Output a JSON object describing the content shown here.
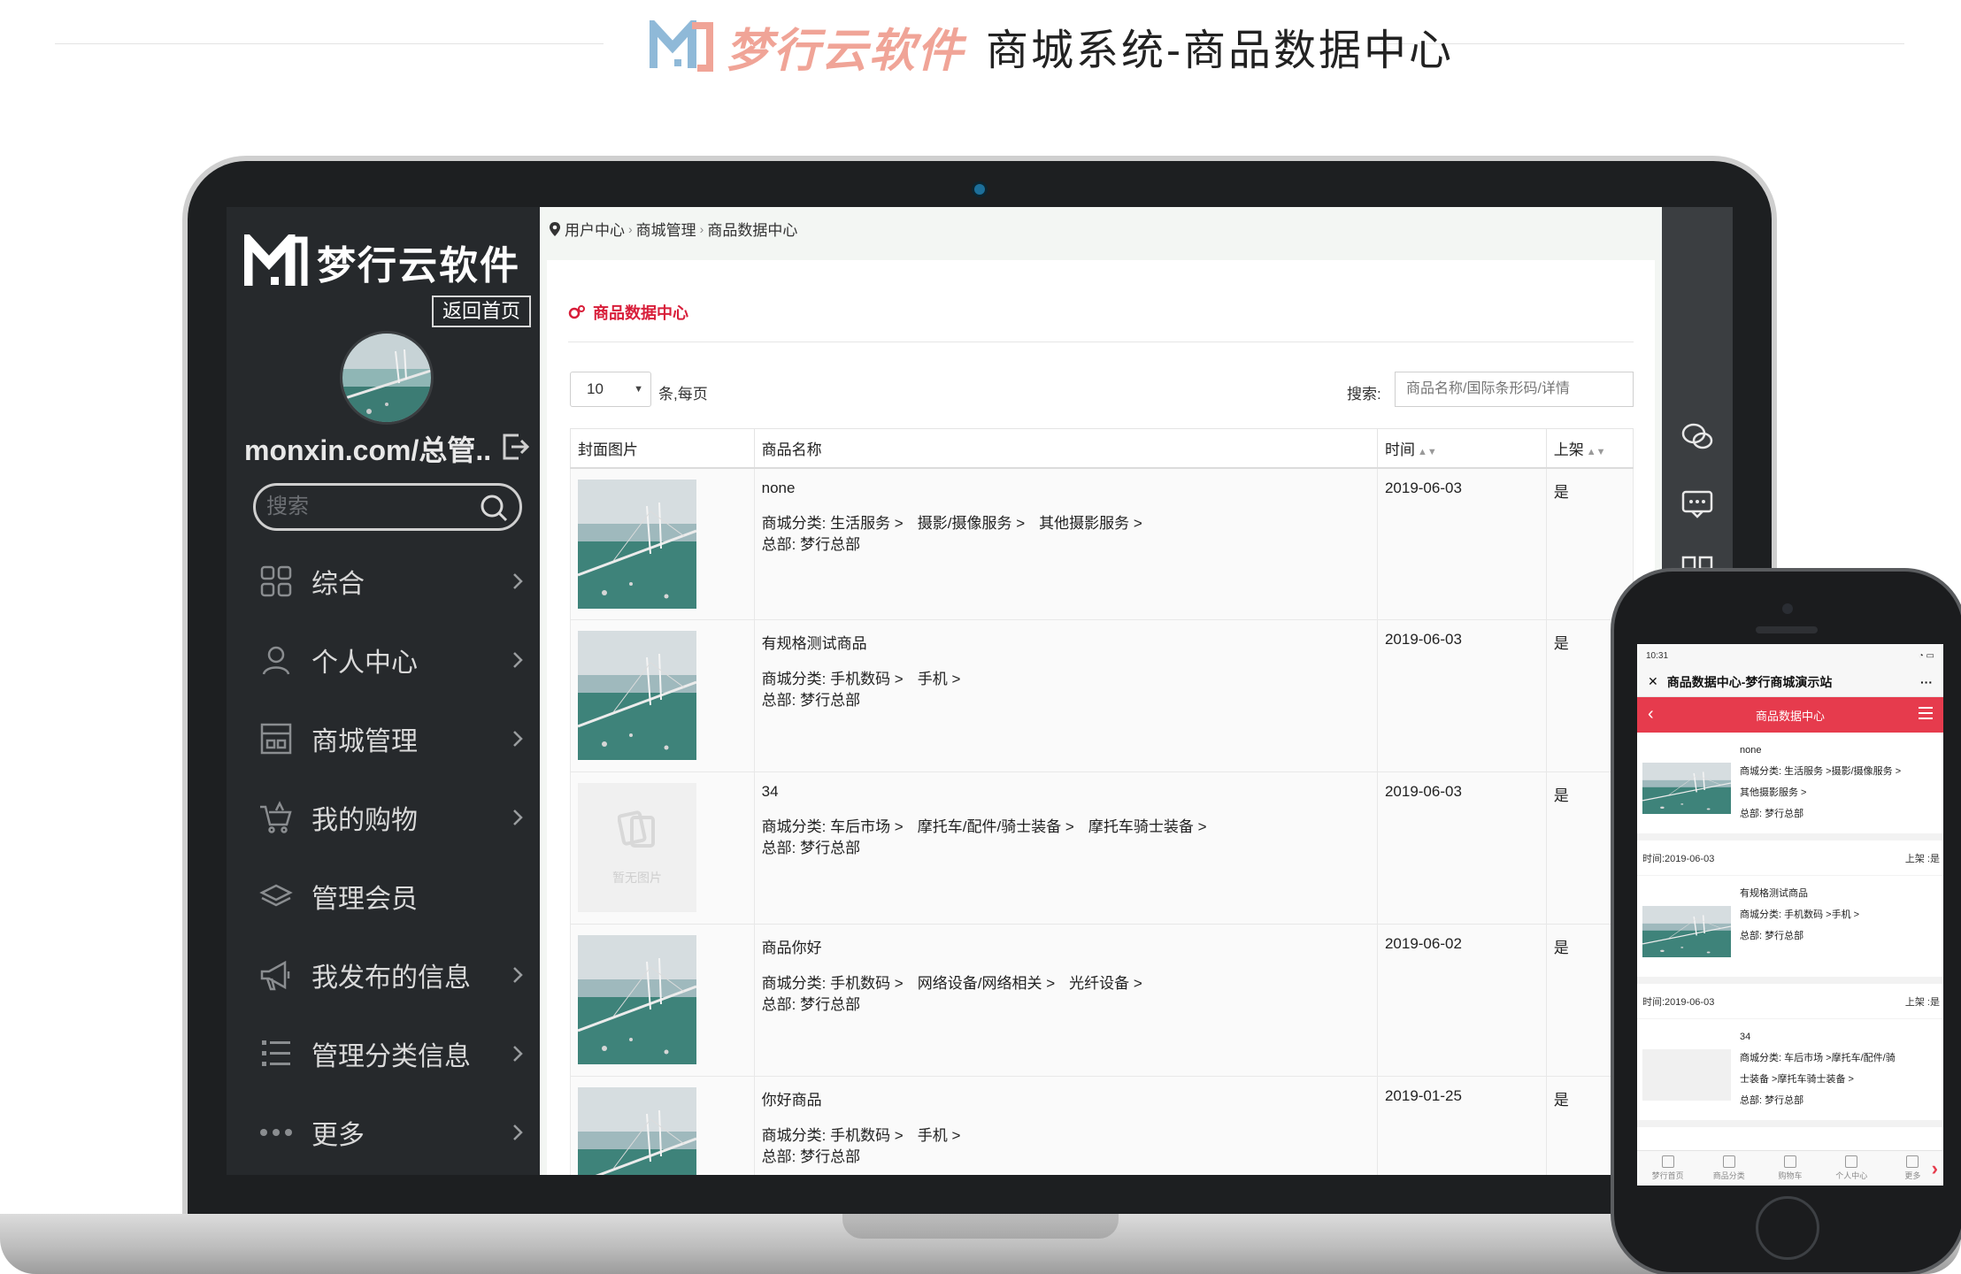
{
  "header": {
    "brand": "梦行云软件",
    "title": "商城系统-商品数据中心"
  },
  "sidebar": {
    "logo_text": "梦行云软件",
    "home_button": "返回首页",
    "username": "monxin.com/总管...",
    "search_placeholder": "搜索",
    "menu": [
      {
        "label": "综合",
        "icon": "grid-icon"
      },
      {
        "label": "个人中心",
        "icon": "user-icon"
      },
      {
        "label": "商城管理",
        "icon": "store-icon"
      },
      {
        "label": "我的购物",
        "icon": "cart-icon"
      },
      {
        "label": "管理会员",
        "icon": "layers-icon"
      },
      {
        "label": "我发布的信息",
        "icon": "megaphone-icon"
      },
      {
        "label": "管理分类信息",
        "icon": "list-icon"
      },
      {
        "label": "更多",
        "icon": "more-icon"
      }
    ]
  },
  "breadcrumb": {
    "items": [
      "用户中心",
      "商城管理",
      "商品数据中心"
    ]
  },
  "content": {
    "title": "商品数据中心",
    "page_size": "10",
    "page_size_label": "条,每页",
    "search_label": "搜索:",
    "search_placeholder": "商品名称/国际条形码/详情",
    "columns": [
      "封面图片",
      "商品名称",
      "时间",
      "上架"
    ],
    "no_image_label": "暂无图片",
    "rows": [
      {
        "name": "none",
        "category": [
          "商城分类: 生活服务 >",
          "摄影/摄像服务 >",
          "其他摄影服务 >"
        ],
        "hq": "总部: 梦行总部",
        "date": "2019-06-03",
        "listed": "是",
        "has_image": true
      },
      {
        "name": "有规格测试商品",
        "category": [
          "商城分类: 手机数码 >",
          "手机 >"
        ],
        "hq": "总部: 梦行总部",
        "date": "2019-06-03",
        "listed": "是",
        "has_image": true
      },
      {
        "name": "34",
        "category": [
          "商城分类: 车后市场 >",
          "摩托车/配件/骑士装备 >",
          "摩托车骑士装备 >"
        ],
        "hq": "总部: 梦行总部",
        "date": "2019-06-03",
        "listed": "是",
        "has_image": false
      },
      {
        "name": "商品你好",
        "category": [
          "商城分类: 手机数码 >",
          "网络设备/网络相关 >",
          "光纤设备 >"
        ],
        "hq": "总部: 梦行总部",
        "date": "2019-06-02",
        "listed": "是",
        "has_image": true
      },
      {
        "name": "你好商品",
        "category": [
          "商城分类: 手机数码 >",
          "手机 >"
        ],
        "hq": "总部: 梦行总部",
        "date": "2019-01-25",
        "listed": "是",
        "has_image": true
      }
    ]
  },
  "phone": {
    "status_time": "10:31",
    "wx_title": "商品数据中心-梦行商城演示站",
    "wx_more": "···",
    "header_title": "商品数据中心",
    "items": [
      {
        "lines": [
          "none",
          "商城分类: 生活服务 >摄影/摄像服务 >",
          "其他摄影服务 >",
          "总部: 梦行总部"
        ],
        "time": "时间:2019-06-03",
        "status": "上架 :是"
      },
      {
        "lines": [
          "有规格测试商品",
          "商城分类: 手机数码 >手机 >",
          "总部: 梦行总部"
        ],
        "time": "时间:2019-06-03",
        "status": "上架 :是"
      },
      {
        "lines": [
          "34",
          "商城分类: 车后市场 >摩托车/配件/骑",
          "士装备 >摩托车骑士装备 >",
          "总部: 梦行总部"
        ]
      }
    ],
    "tabs": [
      "梦行首页",
      "商品分类",
      "购物车",
      "个人中心",
      "更多"
    ]
  },
  "colors": {
    "accent": "#d81e3a",
    "phone_header": "#e63b4d",
    "sidebar_bg": "#26292c",
    "brand_pink": "#f0a497"
  }
}
